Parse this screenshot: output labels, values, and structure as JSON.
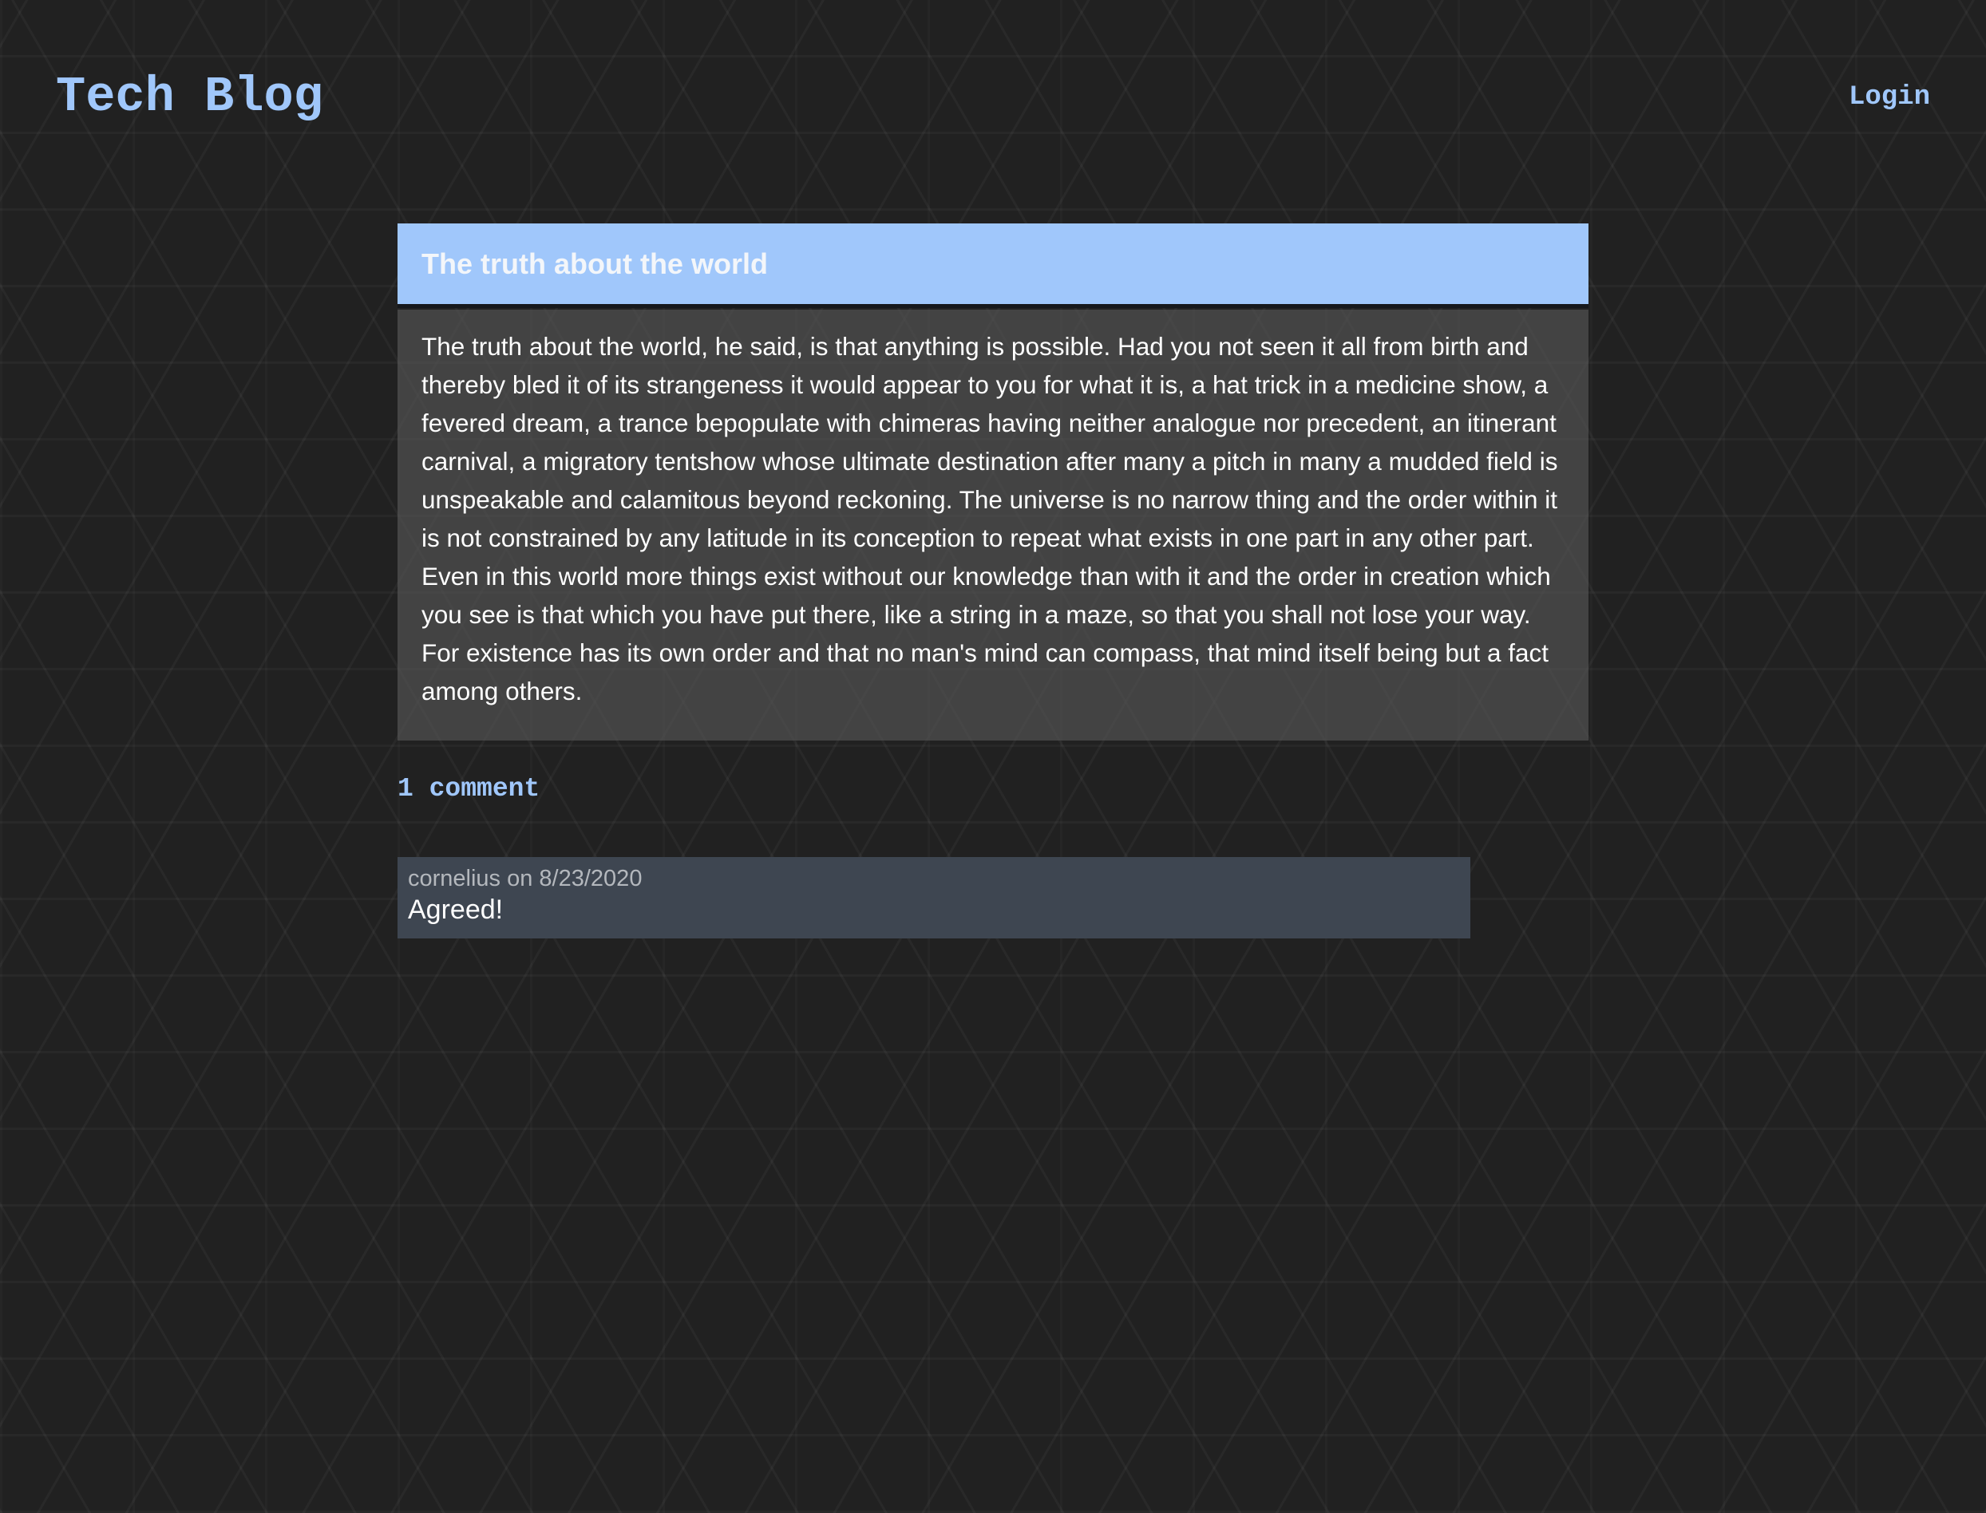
{
  "header": {
    "site_title": "Tech Blog",
    "login_label": "Login"
  },
  "post": {
    "title": "The truth about the world",
    "body": "The truth about the world, he said, is that anything is possible. Had you not seen it all from birth and thereby bled it of its strangeness it would appear to you for what it is, a hat trick in a medicine show, a fevered dream, a trance bepopulate with chimeras having neither analogue nor precedent, an itinerant carnival, a migratory tentshow whose ultimate destination after many a pitch in many a mudded field is unspeakable and calamitous beyond reckoning. The universe is no narrow thing and the order within it is not constrained by any latitude in its conception to repeat what exists in one part in any other part. Even in this world more things exist without our knowledge than with it and the order in creation which you see is that which you have put there, like a string in a maze, so that you shall not lose your way. For existence has its own order and that no man's mind can compass, that mind itself being but a fact among others."
  },
  "comments": {
    "count_label": "1 comment",
    "items": [
      {
        "meta": "cornelius on 8/23/2020",
        "text": "Agreed!"
      }
    ]
  },
  "colors": {
    "accent": "#a0c7fb",
    "background": "#212121",
    "post_body_bg": "#474747",
    "comment_bg": "#3e4651"
  }
}
